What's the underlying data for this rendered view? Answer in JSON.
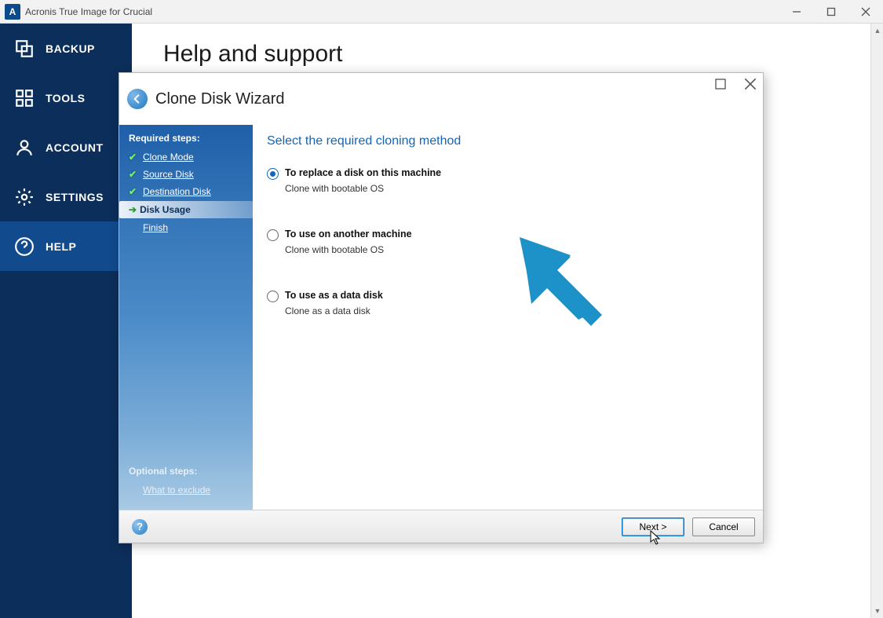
{
  "titlebar": {
    "app_letter": "A",
    "title": "Acronis True Image for Crucial"
  },
  "sidebar": {
    "items": [
      {
        "label": "BACKUP"
      },
      {
        "label": "TOOLS"
      },
      {
        "label": "ACCOUNT"
      },
      {
        "label": "SETTINGS"
      },
      {
        "label": "HELP"
      }
    ]
  },
  "page": {
    "title": "Help and support"
  },
  "wizard": {
    "title": "Clone Disk Wizard",
    "required_steps_title": "Required steps:",
    "steps": [
      {
        "label": "Clone Mode",
        "state": "done"
      },
      {
        "label": "Source Disk",
        "state": "done"
      },
      {
        "label": "Destination Disk",
        "state": "done"
      },
      {
        "label": "Disk Usage",
        "state": "current"
      },
      {
        "label": "Finish",
        "state": "pending"
      }
    ],
    "optional_title": "Optional steps:",
    "optional_items": [
      {
        "label": "What to exclude"
      }
    ],
    "main_title": "Select the required cloning method",
    "options": [
      {
        "label": "To replace a disk on this machine",
        "sub": "Clone with bootable OS",
        "selected": true
      },
      {
        "label": "To use on another machine",
        "sub": "Clone with bootable OS",
        "selected": false
      },
      {
        "label": "To use as a data disk",
        "sub": "Clone as a data disk",
        "selected": false
      }
    ],
    "footer": {
      "next": "Next >",
      "cancel": "Cancel",
      "help": "?"
    }
  }
}
